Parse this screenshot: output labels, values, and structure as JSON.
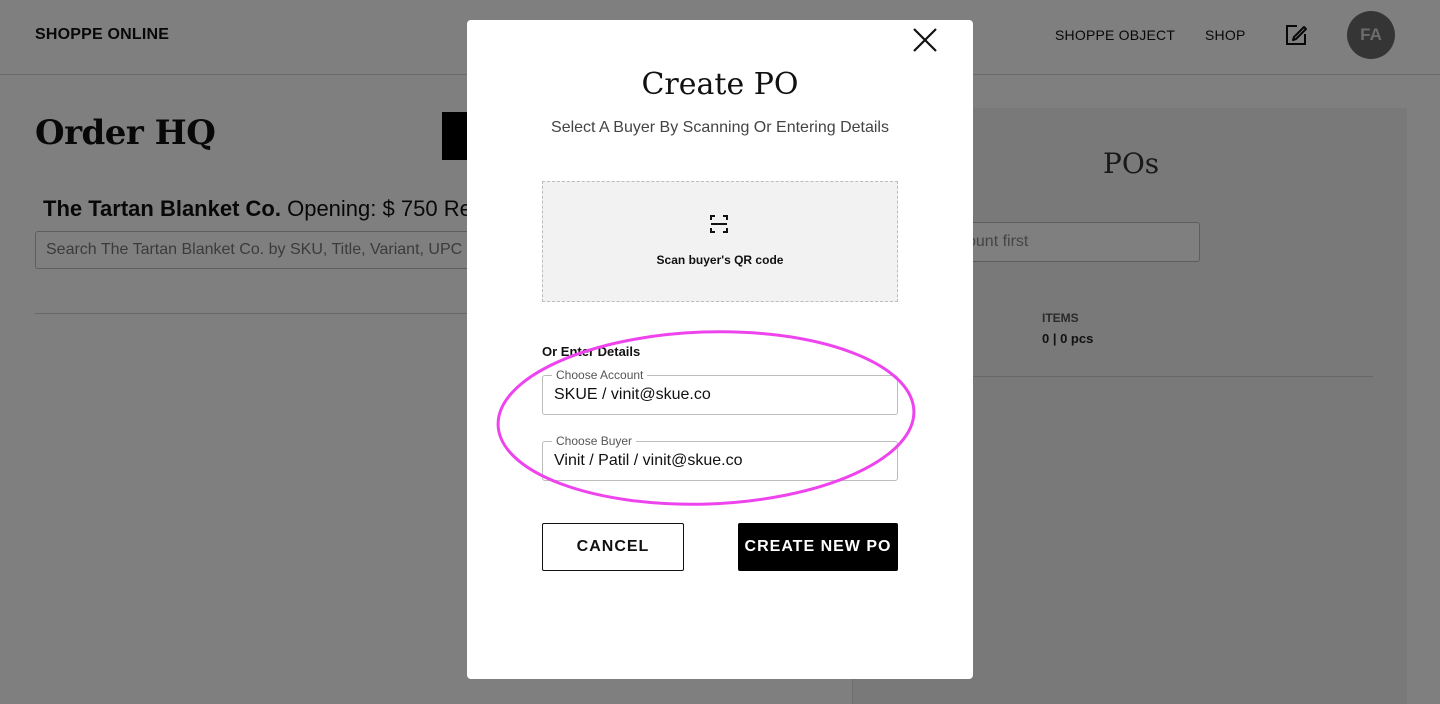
{
  "header": {
    "brand": "SHOPPE ONLINE",
    "nav_items": [
      "SHOPPE OBJECT",
      "SHOP"
    ],
    "avatar_initials": "FA"
  },
  "main": {
    "title": "Order HQ",
    "brand_name": "The Tartan Blanket Co.",
    "opening_text": "Opening: $ 750",
    "truncated_text": "Re",
    "search_placeholder": "Search The Tartan Blanket Co. by SKU, Title, Variant, UPC"
  },
  "right_panel": {
    "title": "POs",
    "account_placeholder_visible": "ount first",
    "items_label": "ITEMS",
    "items_value": "0 | 0 pcs"
  },
  "modal": {
    "title": "Create PO",
    "subtitle": "Select A Buyer By Scanning Or Entering Details",
    "scan_label": "Scan buyer's QR code",
    "or_label": "Or Enter Details",
    "account_legend": "Choose Account",
    "account_value": "SKUE / vinit@skue.co",
    "buyer_legend": "Choose Buyer",
    "buyer_value": "Vinit / Patil / vinit@skue.co",
    "cancel_label": "CANCEL",
    "create_label": "CREATE NEW PO"
  },
  "colors": {
    "highlight": "#ee44ee",
    "overlay": "rgba(0,0,0,0.5)"
  }
}
